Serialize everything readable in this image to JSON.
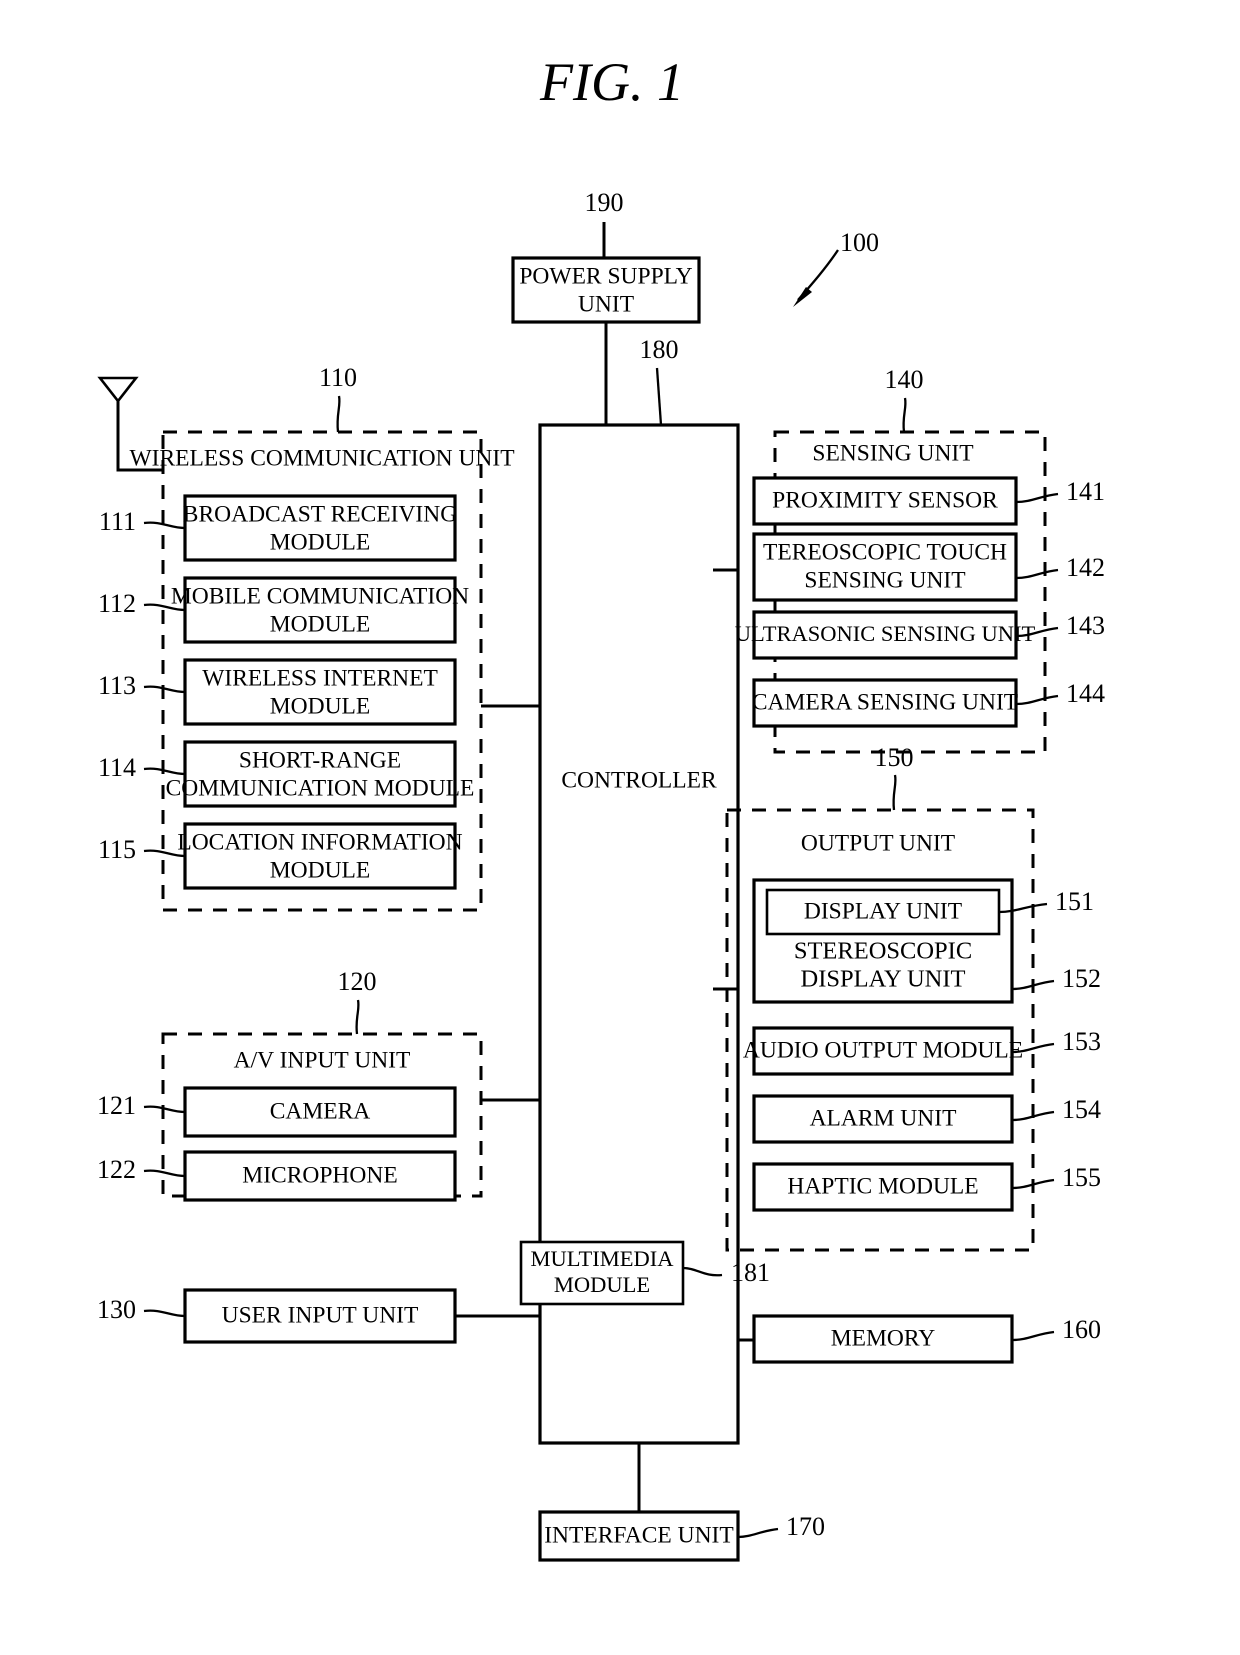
{
  "figure": {
    "title": "FIG.  1",
    "device_ref": "100"
  },
  "power_supply": {
    "ref": "190",
    "label_line1": "POWER  SUPPLY",
    "label_line2": "UNIT"
  },
  "controller": {
    "ref": "180",
    "label": "CONTROLLER"
  },
  "multimedia": {
    "ref": "181",
    "label_line1": "MULTIMEDIA",
    "label_line2": "MODULE"
  },
  "wireless": {
    "ref": "110",
    "title": "WIRELESS COMMUNICATION UNIT",
    "icon": "antenna-icon",
    "items": [
      {
        "ref": "111",
        "line1": "BROADCAST  RECEIVING",
        "line2": "MODULE"
      },
      {
        "ref": "112",
        "line1": "MOBILE  COMMUNICATION",
        "line2": "MODULE"
      },
      {
        "ref": "113",
        "line1": "WIRELESS  INTERNET",
        "line2": "MODULE"
      },
      {
        "ref": "114",
        "line1": "SHORT-RANGE",
        "line2": "COMMUNICATION MODULE"
      },
      {
        "ref": "115",
        "line1": "LOCATION  INFORMATION",
        "line2": "MODULE"
      }
    ]
  },
  "av_input": {
    "ref": "120",
    "title": "A/V  INPUT UNIT",
    "items": [
      {
        "ref": "121",
        "line1": "CAMERA",
        "line2": ""
      },
      {
        "ref": "122",
        "line1": "MICROPHONE",
        "line2": ""
      }
    ]
  },
  "user_input": {
    "ref": "130",
    "label": "USER  INPUT UNIT"
  },
  "sensing": {
    "ref": "140",
    "title": "SENSING UNIT",
    "items": [
      {
        "ref": "141",
        "line1": "PROXIMITY  SENSOR",
        "line2": ""
      },
      {
        "ref": "142",
        "line1": "TEREOSCOPIC  TOUCH",
        "line2": "SENSING  UNIT"
      },
      {
        "ref": "143",
        "line1": "ULTRASONIC  SENSING  UNIT",
        "line2": ""
      },
      {
        "ref": "144",
        "line1": "CAMERA  SENSING  UNIT",
        "line2": ""
      }
    ]
  },
  "output": {
    "ref": "150",
    "title": "OUTPUT UNIT",
    "display": {
      "ref": "151",
      "label": "DISPLAY  UNIT"
    },
    "stereo_display": {
      "ref": "152",
      "line1": "STEREOSCOPIC",
      "line2": "DISPLAY  UNIT"
    },
    "items": [
      {
        "ref": "153",
        "label": "AUDIO OUTPUT MODULE"
      },
      {
        "ref": "154",
        "label": "ALARM  UNIT"
      },
      {
        "ref": "155",
        "label": "HAPTIC  MODULE"
      }
    ]
  },
  "memory": {
    "ref": "160",
    "label": "MEMORY"
  },
  "interface": {
    "ref": "170",
    "label": "INTERFACE  UNIT"
  }
}
